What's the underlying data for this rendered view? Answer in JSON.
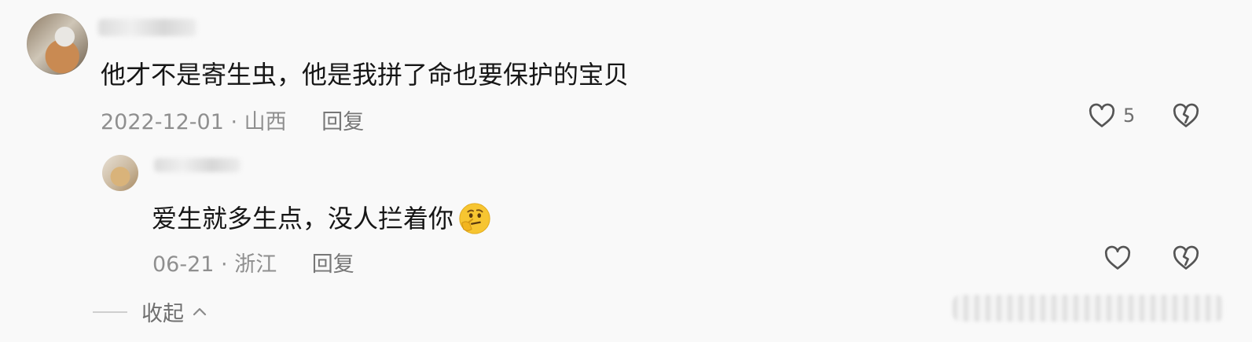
{
  "comment": {
    "text": "他才不是寄生虫，他是我拼了命也要保护的宝贝",
    "date_location": "2022-12-01 · 山西",
    "reply_label": "回复",
    "like_count": "5"
  },
  "reply": {
    "text": "爱生就多生点，没人拦着你",
    "emoji": "thinking-face-emoji",
    "date_location": "06-21 · 浙江",
    "reply_label": "回复"
  },
  "collapse": {
    "label": "收起"
  },
  "icons": {
    "like": "heart-outline-icon",
    "dislike": "broken-heart-icon",
    "collapse": "chevron-up-icon"
  },
  "colors": {
    "background": "#f9f9f9",
    "text_primary": "#161616",
    "text_meta": "#8f8f8f",
    "icon_stroke": "#555555",
    "emoji_yellow": "#f7c531"
  }
}
